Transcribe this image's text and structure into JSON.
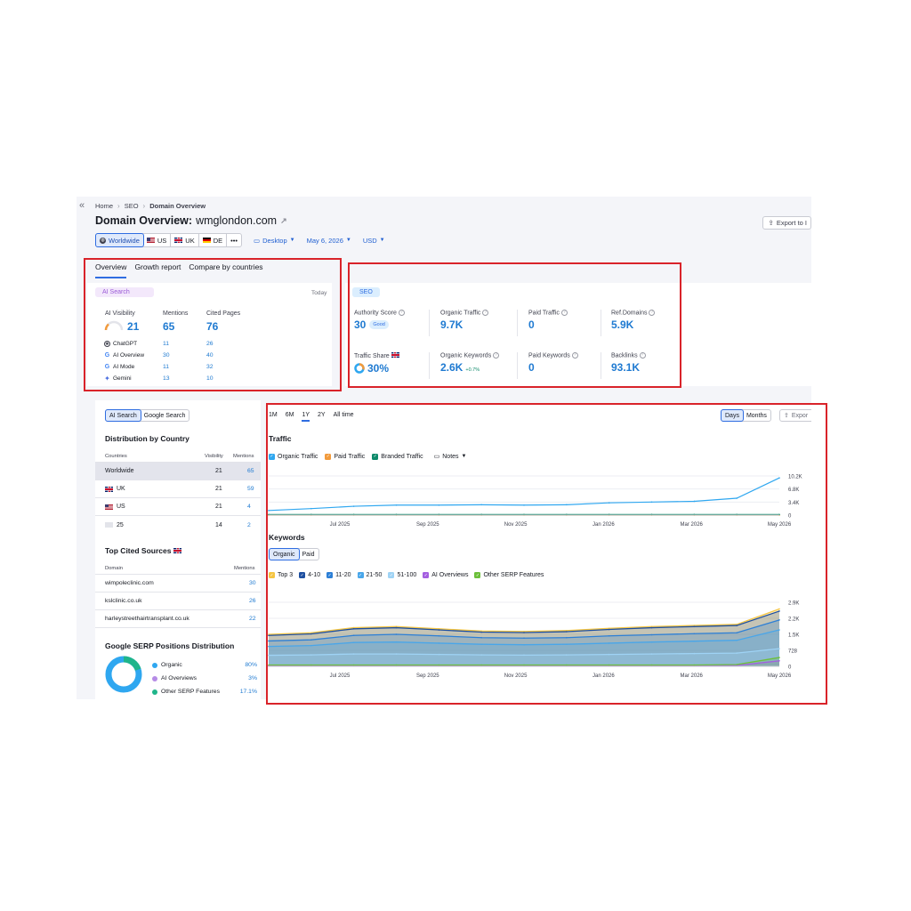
{
  "breadcrumb": {
    "items": [
      "Home",
      "SEO",
      "Domain Overview"
    ]
  },
  "header": {
    "title_prefix": "Domain Overview:",
    "domain": "wmglondon.com",
    "export_label": "Export to I"
  },
  "filters": {
    "regions": [
      "Worldwide",
      "US",
      "UK",
      "DE",
      "•••"
    ],
    "device": "Desktop",
    "date": "May 6, 2026",
    "currency": "USD"
  },
  "tabs": [
    "Overview",
    "Growth report",
    "Compare by countries"
  ],
  "ai_search": {
    "pill": "AI Search",
    "today": "Today",
    "headers": [
      "AI Visibility",
      "Mentions",
      "Cited Pages"
    ],
    "totals": {
      "visibility": "21",
      "mentions": "65",
      "cited": "76"
    },
    "rows": [
      {
        "name": "ChatGPT",
        "mentions": "11",
        "cited": "26"
      },
      {
        "name": "AI Overview",
        "mentions": "30",
        "cited": "40"
      },
      {
        "name": "AI Mode",
        "mentions": "11",
        "cited": "32"
      },
      {
        "name": "Gemini",
        "mentions": "13",
        "cited": "10"
      }
    ]
  },
  "seo": {
    "pill": "SEO",
    "metrics": [
      {
        "label": "Authority Score",
        "value": "30",
        "badge": "Good"
      },
      {
        "label": "Organic Traffic",
        "value": "9.7K"
      },
      {
        "label": "Paid Traffic",
        "value": "0"
      },
      {
        "label": "Ref.Domains",
        "value": "5.9K"
      },
      {
        "label": "Traffic Share",
        "value": "30%"
      },
      {
        "label": "Organic Keywords",
        "value": "2.6K",
        "delta": "+0.7%"
      },
      {
        "label": "Paid Keywords",
        "value": "0"
      },
      {
        "label": "Backlinks",
        "value": "93.1K"
      }
    ]
  },
  "left_panel": {
    "toggle": [
      "AI Search",
      "Google Search"
    ],
    "dist_title": "Distribution by Country",
    "dist_headers": [
      "Countries",
      "Visibility",
      "Mentions"
    ],
    "dist_rows": [
      {
        "country": "Worldwide",
        "visibility": "21",
        "mentions": "65"
      },
      {
        "country": "UK",
        "visibility": "21",
        "mentions": "59"
      },
      {
        "country": "US",
        "visibility": "21",
        "mentions": "4"
      },
      {
        "country": "25",
        "visibility": "14",
        "mentions": "2"
      }
    ],
    "cited_title": "Top Cited Sources",
    "cited_headers": [
      "Domain",
      "Mentions"
    ],
    "cited_rows": [
      {
        "domain": "wimpoleclinic.com",
        "mentions": "30"
      },
      {
        "domain": "kslclinic.co.uk",
        "mentions": "26"
      },
      {
        "domain": "harleystreethairtransplant.co.uk",
        "mentions": "22"
      }
    ],
    "serp_title": "Google SERP Positions Distribution",
    "serp_rows": [
      {
        "label": "Organic",
        "value": "80%",
        "color": "#2fa7f0"
      },
      {
        "label": "AI Overviews",
        "value": "3%",
        "color": "#b58be6"
      },
      {
        "label": "Other SERP Features",
        "value": "17.1%",
        "color": "#1fb58a"
      }
    ]
  },
  "charts_panel": {
    "ranges": [
      "1M",
      "6M",
      "1Y",
      "2Y",
      "All time"
    ],
    "active_range": "1Y",
    "view": [
      "Days",
      "Months"
    ],
    "export_label": "Expor",
    "traffic_title": "Traffic",
    "traffic_legend": [
      {
        "label": "Organic Traffic",
        "color": "#2fa7f0"
      },
      {
        "label": "Paid Traffic",
        "color": "#f29a3b"
      },
      {
        "label": "Branded Traffic",
        "color": "#0e8a6a"
      }
    ],
    "notes_label": "Notes",
    "keywords_title": "Keywords",
    "kw_toggle": [
      "Organic",
      "Paid"
    ],
    "kw_legend": [
      {
        "label": "Top 3",
        "color": "#f5c542"
      },
      {
        "label": "4-10",
        "color": "#1e4fa0"
      },
      {
        "label": "11-20",
        "color": "#2c7fd6"
      },
      {
        "label": "21-50",
        "color": "#48a6ea"
      },
      {
        "label": "51-100",
        "color": "#9fd3f5"
      },
      {
        "label": "AI Overviews",
        "color": "#a45fe0"
      },
      {
        "label": "Other SERP Features",
        "color": "#6cbf3a"
      }
    ]
  },
  "chart_data": [
    {
      "type": "line",
      "title": "Traffic",
      "x": [
        "Jun 2025",
        "Jul 2025",
        "Aug 2025",
        "Sep 2025",
        "Oct 2025",
        "Nov 2025",
        "Dec 2025",
        "Jan 2026",
        "Feb 2026",
        "Mar 2026",
        "Apr 2026",
        "Apr 20 2026",
        "May 2026"
      ],
      "x_tick_labels": [
        "Jul 2025",
        "Sep 2025",
        "Nov 2025",
        "Jan 2026",
        "Mar 2026",
        "May 2026"
      ],
      "y_tick_labels": [
        "0",
        "3.4K",
        "6.8K",
        "10.2K"
      ],
      "ylim": [
        0,
        10200
      ],
      "series": [
        {
          "name": "Organic Traffic",
          "color": "#2fa7f0",
          "values": [
            1200,
            1700,
            2300,
            2600,
            2600,
            2700,
            2600,
            2700,
            3200,
            3400,
            3600,
            4400,
            9700
          ]
        },
        {
          "name": "Paid Traffic",
          "color": "#f29a3b",
          "values": [
            0,
            0,
            0,
            0,
            0,
            0,
            0,
            0,
            0,
            0,
            0,
            0,
            0
          ]
        },
        {
          "name": "Branded Traffic",
          "color": "#0e8a6a",
          "values": [
            150,
            150,
            150,
            150,
            150,
            150,
            150,
            150,
            150,
            150,
            150,
            150,
            150
          ]
        }
      ]
    },
    {
      "type": "area",
      "title": "Keywords",
      "x": [
        "Jun 2025",
        "Jul 2025",
        "Aug 2025",
        "Sep 2025",
        "Oct 2025",
        "Nov 2025",
        "Dec 2025",
        "Jan 2026",
        "Feb 2026",
        "Mar 2026",
        "Apr 2026",
        "Apr 20 2026",
        "May 2026"
      ],
      "x_tick_labels": [
        "Jul 2025",
        "Sep 2025",
        "Nov 2025",
        "Jan 2026",
        "Mar 2026",
        "May 2026"
      ],
      "y_tick_labels": [
        "0",
        "728",
        "1.5K",
        "2.2K",
        "2.9K"
      ],
      "ylim": [
        0,
        2900
      ],
      "series": [
        {
          "name": "Top 3",
          "color": "#f5c542",
          "values": [
            1450,
            1520,
            1750,
            1800,
            1700,
            1600,
            1580,
            1620,
            1720,
            1800,
            1850,
            1900,
            2600
          ]
        },
        {
          "name": "4-10",
          "color": "#1e4fa0",
          "values": [
            1400,
            1470,
            1700,
            1750,
            1650,
            1550,
            1530,
            1570,
            1670,
            1750,
            1800,
            1850,
            2500
          ]
        },
        {
          "name": "11-20",
          "color": "#2c7fd6",
          "values": [
            1150,
            1200,
            1400,
            1450,
            1380,
            1300,
            1280,
            1300,
            1380,
            1430,
            1480,
            1520,
            2100
          ]
        },
        {
          "name": "21-50",
          "color": "#48a6ea",
          "values": [
            900,
            940,
            1080,
            1100,
            1050,
            1000,
            980,
            1000,
            1050,
            1100,
            1140,
            1180,
            1650
          ]
        },
        {
          "name": "51-100",
          "color": "#9fd3f5",
          "values": [
            500,
            520,
            560,
            560,
            540,
            520,
            510,
            520,
            540,
            560,
            580,
            600,
            800
          ]
        },
        {
          "name": "AI Overviews",
          "color": "#a45fe0",
          "values": [
            20,
            20,
            20,
            20,
            20,
            20,
            20,
            20,
            20,
            20,
            20,
            40,
            250
          ]
        },
        {
          "name": "Other SERP Features",
          "color": "#6cbf3a",
          "values": [
            60,
            60,
            60,
            60,
            60,
            60,
            60,
            60,
            60,
            60,
            60,
            80,
            400
          ]
        }
      ]
    }
  ]
}
